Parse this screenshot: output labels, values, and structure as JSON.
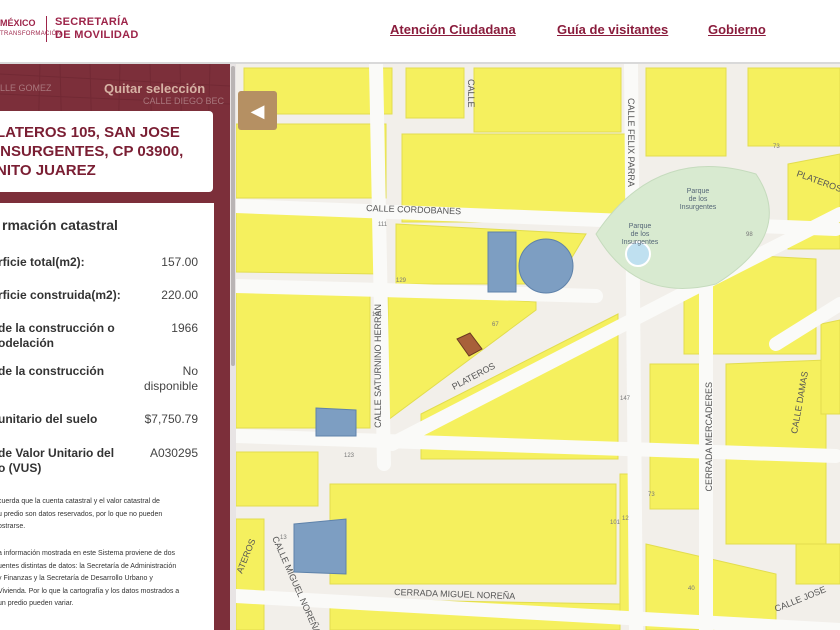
{
  "header": {
    "logo_mexico": "MÉXICO",
    "logo_mexico_sub": "TRANSFORMACIÓN",
    "logo_secretaria": "SECRETARÍA\nDE MOVILIDAD",
    "nav": [
      "Atención Ciudadana",
      "Guía de visitantes",
      "Gobierno"
    ]
  },
  "panel": {
    "clear_selection": "Quitar selección",
    "bg_streets": [
      "LLE GOMEZ",
      "CALLE DIEGO BEC"
    ],
    "address": "LATEROS 105, SAN JOSE\nINSURGENTES, CP 03900,\nNITO JUAREZ",
    "info_title": "rmación catastral",
    "rows": [
      {
        "label": "rficie total(m2):",
        "value": "157.00"
      },
      {
        "label": "rficie construida(m2):",
        "value": "220.00"
      },
      {
        "label": "de la construcción o\nodelación",
        "value": "1966"
      },
      {
        "label": "de la construcción",
        "value": "No\ndisponible"
      },
      {
        "label": "unitario del suelo",
        "value": "$7,750.79"
      },
      {
        "label": "de Valor Unitario del\no (VUS)",
        "value": "A030295"
      }
    ],
    "note1": "cuerda que la cuenta catastral y el valor catastral de\nu predio son datos reservados, por lo que no pueden\nostrarse.",
    "note2": "a información mostrada en este Sistema proviene de dos\nuentes distintas de datos: la Secretaría de Administración\ny Finanzas y la Secretaría de Desarrollo Urbano y\nVivienda. Por lo que la cartografía y los datos mostrados a\nun predio pueden variar."
  },
  "map": {
    "collapse_icon": "chevron-left-icon",
    "colors": {
      "block": "#f5f05e",
      "street": "#fafaf8",
      "park": "#d8ead0",
      "parcel": "#7d9ec2",
      "selected": "#a8603a"
    },
    "streets": [
      "CALLE FELIX PARRA",
      "CALLE CORDOBANES",
      "CALLE SATURNINO HERRAN",
      "PLATEROS",
      "CERRADA MERCADERES",
      "CALLE DAMAS",
      "CALLE MIGUEL NOREÑA",
      "CERRADA MIGUEL NOREÑA",
      "CALLE JOSE",
      "ATEROS",
      "CALLE"
    ],
    "park_labels": [
      "Parque\nde los\nInsurgentes",
      "Parque\nde los\nInsurgentes"
    ],
    "lot_numbers": [
      "73",
      "98",
      "111",
      "129",
      "121",
      "67",
      "147",
      "73",
      "123",
      "101",
      "13",
      "40",
      "12"
    ]
  }
}
